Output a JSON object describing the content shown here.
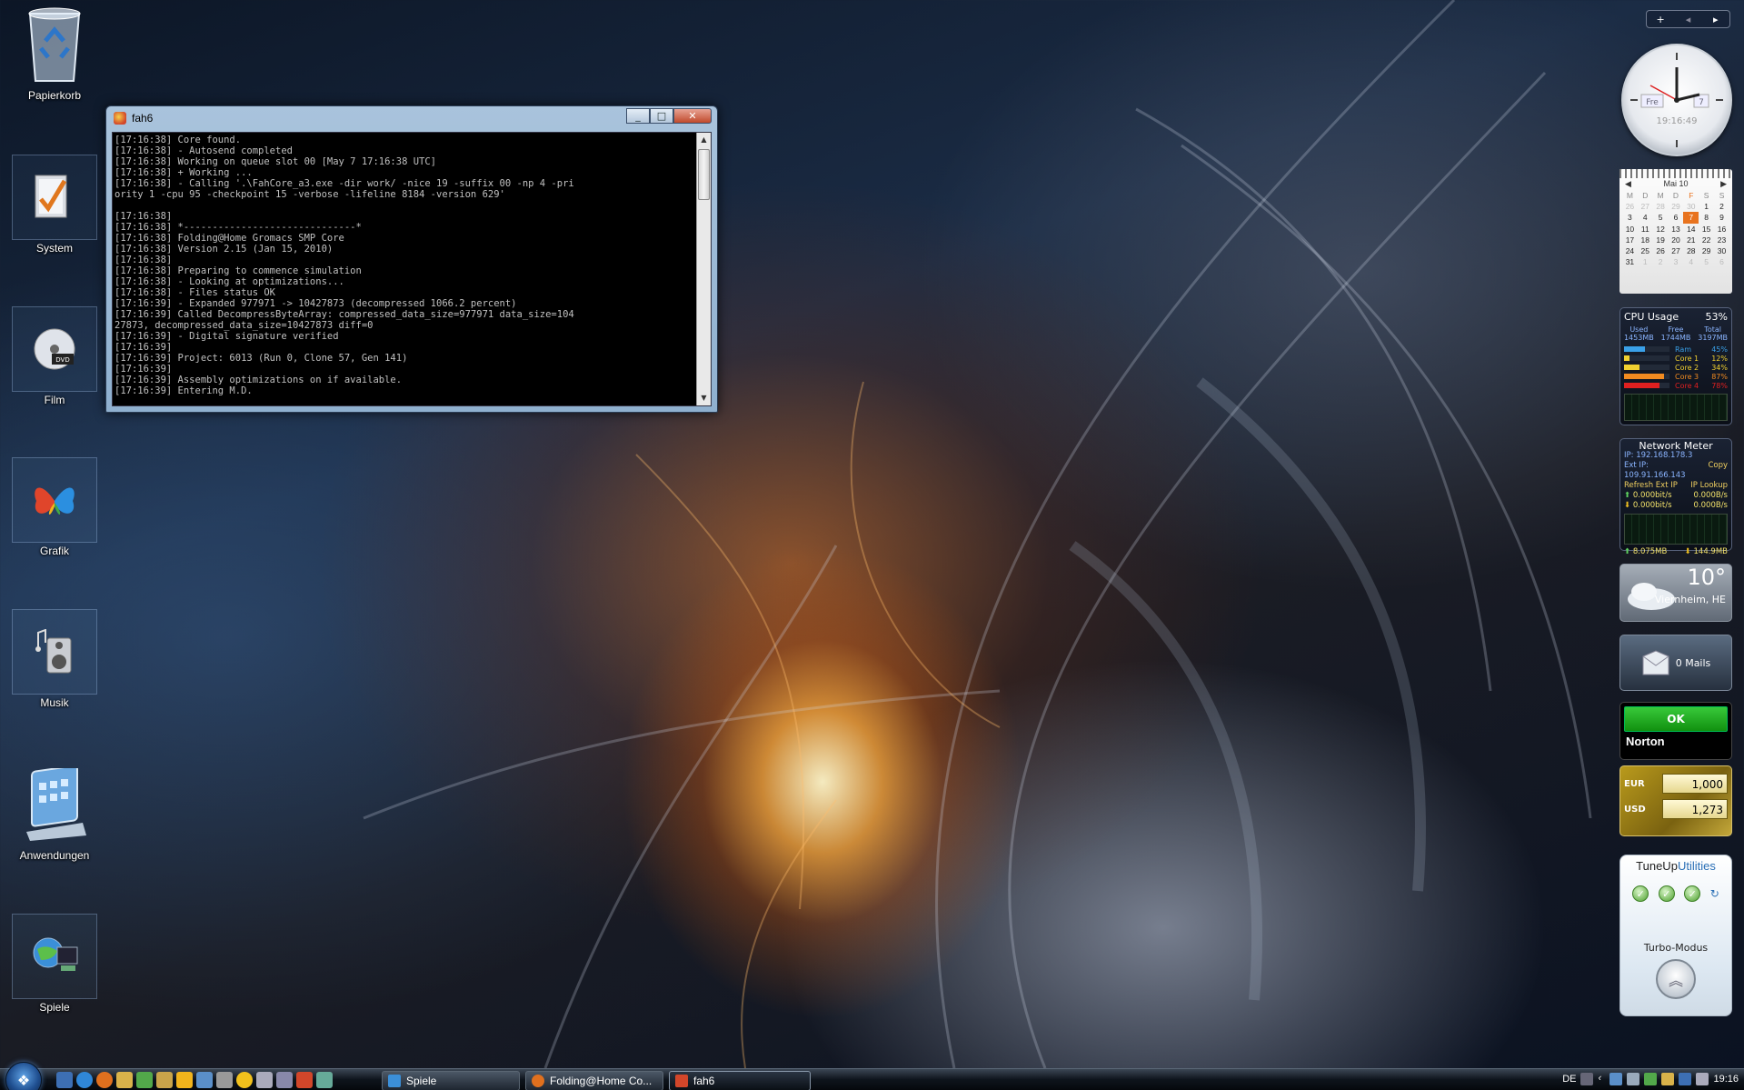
{
  "desktop": {
    "icons": [
      {
        "label": "Papierkorb"
      },
      {
        "label": "System"
      },
      {
        "label": "Film"
      },
      {
        "label": "Grafik"
      },
      {
        "label": "Musik"
      },
      {
        "label": "Anwendungen"
      },
      {
        "label": "Spiele"
      }
    ],
    "dvd_label": "DVD"
  },
  "console_window": {
    "title": "fah6",
    "minimize": "_",
    "maximize": "□",
    "close": "✕",
    "lines": [
      "[17:16:38] Core found.",
      "[17:16:38] - Autosend completed",
      "[17:16:38] Working on queue slot 00 [May 7 17:16:38 UTC]",
      "[17:16:38] + Working ...",
      "[17:16:38] - Calling '.\\FahCore_a3.exe -dir work/ -nice 19 -suffix 00 -np 4 -pri",
      "ority 1 -cpu 95 -checkpoint 15 -verbose -lifeline 8184 -version 629'",
      "",
      "[17:16:38]",
      "[17:16:38] *------------------------------*",
      "[17:16:38] Folding@Home Gromacs SMP Core",
      "[17:16:38] Version 2.15 (Jan 15, 2010)",
      "[17:16:38]",
      "[17:16:38] Preparing to commence simulation",
      "[17:16:38] - Looking at optimizations...",
      "[17:16:38] - Files status OK",
      "[17:16:39] - Expanded 977971 -> 10427873 (decompressed 1066.2 percent)",
      "[17:16:39] Called DecompressByteArray: compressed_data_size=977971 data_size=104",
      "27873, decompressed_data_size=10427873 diff=0",
      "[17:16:39] - Digital signature verified",
      "[17:16:39]",
      "[17:16:39] Project: 6013 (Run 0, Clone 57, Gen 141)",
      "[17:16:39]",
      "[17:16:39] Assembly optimizations on if available.",
      "[17:16:39] Entering M.D.",
      "_"
    ]
  },
  "sidebar": {
    "controls": {
      "add": "+",
      "prev": "◂",
      "next": "▸"
    },
    "clock": {
      "day": "Fre",
      "date": "7",
      "time": "19:16:49"
    },
    "calendar": {
      "month": "Mai 10",
      "prev": "◀",
      "next": "▶",
      "weekdays": [
        "M",
        "D",
        "M",
        "D",
        "F",
        "S",
        "S"
      ],
      "weeks": [
        [
          "26",
          "27",
          "28",
          "29",
          "30",
          "1",
          "2"
        ],
        [
          "3",
          "4",
          "5",
          "6",
          "7",
          "8",
          "9"
        ],
        [
          "10",
          "11",
          "12",
          "13",
          "14",
          "15",
          "16"
        ],
        [
          "17",
          "18",
          "19",
          "20",
          "21",
          "22",
          "23"
        ],
        [
          "24",
          "25",
          "26",
          "27",
          "28",
          "29",
          "30"
        ],
        [
          "31",
          "1",
          "2",
          "3",
          "4",
          "5",
          "6"
        ]
      ],
      "today": "7"
    },
    "cpu": {
      "title": "CPU Usage",
      "total_percent": "53%",
      "headers": [
        "Used",
        "Free",
        "Total"
      ],
      "mem": [
        "1453MB",
        "1744MB",
        "3197MB"
      ],
      "rows": [
        {
          "name": "Ram",
          "value": "45%",
          "fill": 0.45,
          "color": "#3aa0e8"
        },
        {
          "name": "Core 1",
          "value": "12%",
          "fill": 0.12,
          "color": "#f0d030"
        },
        {
          "name": "Core 2",
          "value": "34%",
          "fill": 0.34,
          "color": "#f0d030"
        },
        {
          "name": "Core 3",
          "value": "87%",
          "fill": 0.87,
          "color": "#f08a20"
        },
        {
          "name": "Core 4",
          "value": "78%",
          "fill": 0.78,
          "color": "#e02020"
        }
      ]
    },
    "network": {
      "title": "Network Meter",
      "ip": "IP: 192.168.178.3",
      "ext_ip": "Ext IP: 109.91.166.143",
      "copy": "Copy",
      "refresh": "Refresh Ext IP",
      "lookup": "IP Lookup",
      "up_bits": "0.000bit/s",
      "up_bytes": "0.000B/s",
      "down_bits": "0.000bit/s",
      "down_bytes": "0.000B/s",
      "total_up": "8.075MB",
      "total_down": "144.9MB"
    },
    "weather": {
      "temp": "10°",
      "city": "Viernheim, HE"
    },
    "mail": {
      "label": "0 Mails"
    },
    "norton": {
      "status": "OK",
      "brand": "Norton"
    },
    "currency": [
      {
        "code": "EUR",
        "value": "1,000"
      },
      {
        "code": "USD",
        "value": "1,273"
      }
    ],
    "tuneup": {
      "brand_a": "TuneUp",
      "brand_b": "Utilities",
      "turbo": "Turbo-Modus"
    }
  },
  "taskbar": {
    "buttons": [
      {
        "label": "Spiele"
      },
      {
        "label": "Folding@Home Co..."
      },
      {
        "label": "fah6"
      }
    ],
    "lang": "DE",
    "time": "19:16"
  }
}
